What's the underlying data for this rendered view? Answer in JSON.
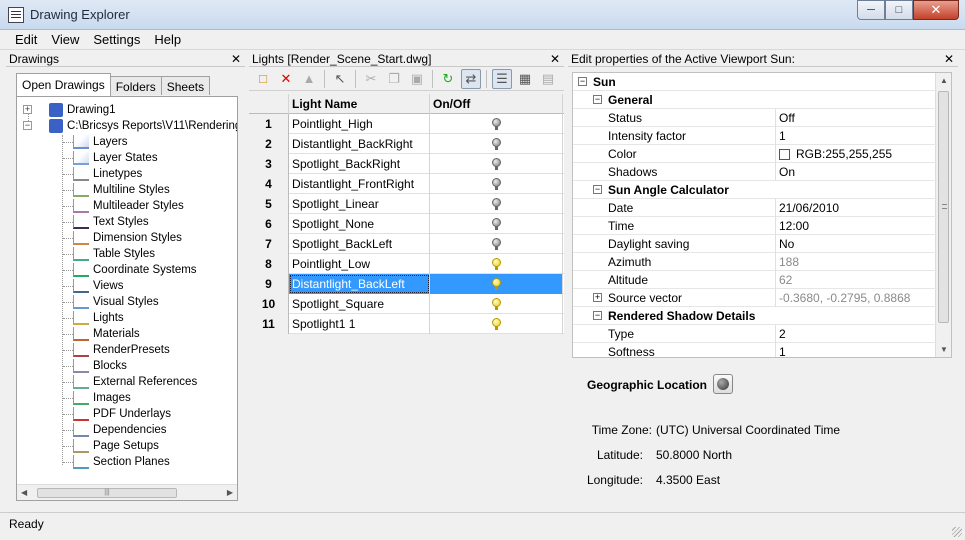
{
  "window": {
    "title": "Drawing Explorer"
  },
  "menu": [
    "Edit",
    "View",
    "Settings",
    "Help"
  ],
  "left_panel": {
    "header": "Drawings",
    "tabs": [
      "Open Drawings",
      "Folders",
      "Sheets"
    ],
    "tree_roots": [
      "Drawing1",
      "C:\\Bricsys Reports\\V11\\Rendering"
    ],
    "tree_items": [
      {
        "label": "Layers",
        "icon": "layers-icon"
      },
      {
        "label": "Layer States",
        "icon": "layer-states-icon"
      },
      {
        "label": "Linetypes",
        "icon": "linetypes-icon"
      },
      {
        "label": "Multiline Styles",
        "icon": "multiline-styles-icon"
      },
      {
        "label": "Multileader Styles",
        "icon": "multileader-styles-icon"
      },
      {
        "label": "Text Styles",
        "icon": "text-styles-icon"
      },
      {
        "label": "Dimension Styles",
        "icon": "dimension-styles-icon"
      },
      {
        "label": "Table Styles",
        "icon": "table-styles-icon"
      },
      {
        "label": "Coordinate Systems",
        "icon": "coordinate-systems-icon"
      },
      {
        "label": "Views",
        "icon": "views-icon"
      },
      {
        "label": "Visual Styles",
        "icon": "visual-styles-icon"
      },
      {
        "label": "Lights",
        "icon": "lights-icon"
      },
      {
        "label": "Materials",
        "icon": "materials-icon"
      },
      {
        "label": "RenderPresets",
        "icon": "render-presets-icon"
      },
      {
        "label": "Blocks",
        "icon": "blocks-icon"
      },
      {
        "label": "External References",
        "icon": "external-references-icon"
      },
      {
        "label": "Images",
        "icon": "images-icon"
      },
      {
        "label": "PDF Underlays",
        "icon": "pdf-underlays-icon"
      },
      {
        "label": "Dependencies",
        "icon": "dependencies-icon"
      },
      {
        "label": "Page Setups",
        "icon": "page-setups-icon"
      },
      {
        "label": "Section Planes",
        "icon": "section-planes-icon"
      }
    ]
  },
  "mid_panel": {
    "header": "Lights [Render_Scene_Start.dwg]",
    "columns": [
      "",
      "Light Name",
      "On/Off"
    ],
    "rows": [
      {
        "n": "1",
        "name": "Pointlight_High",
        "on": false
      },
      {
        "n": "2",
        "name": "Distantlight_BackRight",
        "on": false
      },
      {
        "n": "3",
        "name": "Spotlight_BackRight",
        "on": false
      },
      {
        "n": "4",
        "name": "Distantlight_FrontRight",
        "on": false
      },
      {
        "n": "5",
        "name": "Spotlight_Linear",
        "on": false
      },
      {
        "n": "6",
        "name": "Spotlight_None",
        "on": false
      },
      {
        "n": "7",
        "name": "Spotlight_BackLeft",
        "on": false
      },
      {
        "n": "8",
        "name": "Pointlight_Low",
        "on": true
      },
      {
        "n": "9",
        "name": "Distantlight_BackLeft",
        "on": true,
        "selected": true
      },
      {
        "n": "10",
        "name": "Spotlight_Square",
        "on": true
      },
      {
        "n": "11",
        "name": "Spotlight1 1",
        "on": true
      }
    ]
  },
  "right_panel": {
    "header": "Edit properties of the Active Viewport Sun:",
    "root": "Sun",
    "categories": [
      {
        "name": "General",
        "props": [
          {
            "k": "Status",
            "v": "Off"
          },
          {
            "k": "Intensity factor",
            "v": "1"
          },
          {
            "k": "Color",
            "v": "RGB:255,255,255",
            "swatch": "#ffffff"
          },
          {
            "k": "Shadows",
            "v": "On"
          }
        ]
      },
      {
        "name": "Sun Angle Calculator",
        "props": [
          {
            "k": "Date",
            "v": "21/06/2010"
          },
          {
            "k": "Time",
            "v": "12:00"
          },
          {
            "k": "Daylight saving",
            "v": "No"
          },
          {
            "k": "Azimuth",
            "v": "188",
            "grey": true
          },
          {
            "k": "Altitude",
            "v": "62",
            "grey": true
          },
          {
            "k": "Source vector",
            "v": "-0.3680, -0.2795, 0.8868",
            "grey": true,
            "expandable": true
          }
        ]
      },
      {
        "name": "Rendered Shadow Details",
        "props": [
          {
            "k": "Type",
            "v": "2"
          },
          {
            "k": "Softness",
            "v": "1"
          }
        ]
      }
    ],
    "geo": {
      "title": "Geographic Location",
      "time_zone_label": "Time Zone:",
      "time_zone": "(UTC) Universal Coordinated Time",
      "latitude_label": "Latitude:",
      "latitude": "50.8000 North",
      "longitude_label": "Longitude:",
      "longitude": "4.3500 East"
    }
  },
  "status": "Ready"
}
